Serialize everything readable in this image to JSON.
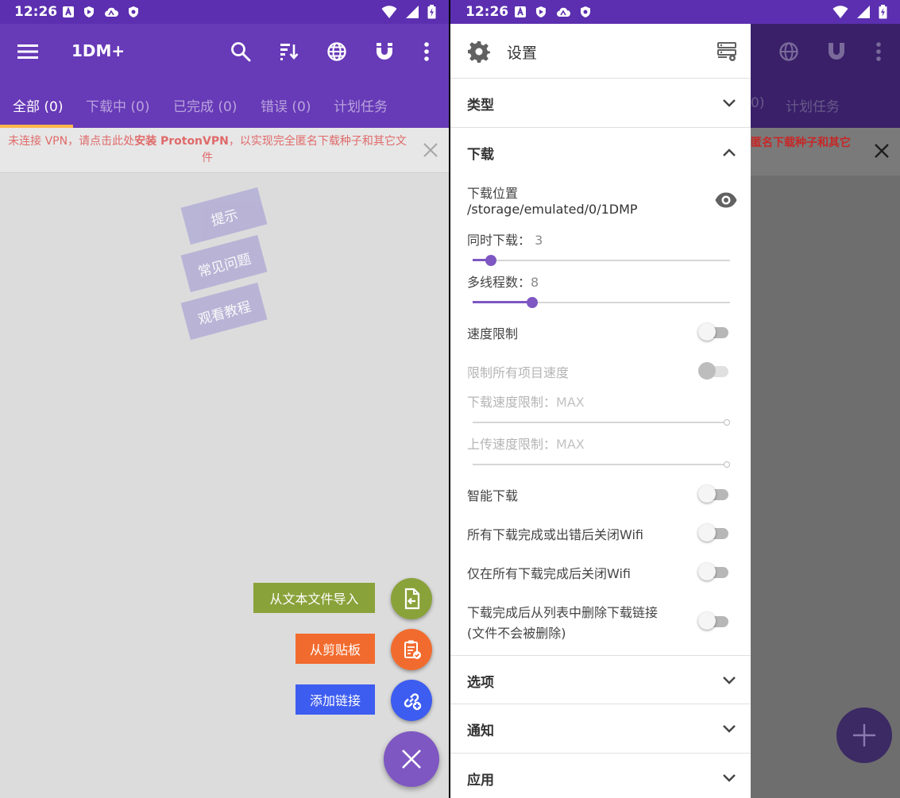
{
  "status_bar": {
    "time": "12:26"
  },
  "app": {
    "title": "1DM+",
    "tabs": [
      {
        "label": "全部 (0)"
      },
      {
        "label": "下载中 (0)"
      },
      {
        "label": "已完成 (0)"
      },
      {
        "label": "错误 (0)"
      },
      {
        "label": "计划任务"
      }
    ]
  },
  "banner": {
    "text_a": "未连接 VPN，请点击此处",
    "text_bold": "安装 ProtonVPN",
    "text_b": "，以实现完全匿名下载种子和其它文件",
    "dim_fragment": "匿名下载种子和其它"
  },
  "tips": [
    "提示",
    "常见问题",
    "观看教程"
  ],
  "fab": {
    "import_text_label": "从文本文件导入",
    "clipboard_label": "从剪贴板",
    "add_link_label": "添加链接",
    "colors": {
      "import": "#8aa23a",
      "clipboard": "#f26b2e",
      "link": "#3d5cf0",
      "main": "#7e57c2"
    }
  },
  "dim_tabs": {
    "errors_tail": "0)",
    "scheduled": "计划任务"
  },
  "settings": {
    "title": "设置",
    "sections": {
      "type": "类型",
      "download": "下载",
      "options": "选项",
      "notify": "通知",
      "apply": "应用"
    },
    "download": {
      "location_label": "下载位置",
      "location_path": "/storage/emulated/0/1DMP",
      "concurrent_label": "同时下载：",
      "concurrent_value": "3",
      "concurrent_fraction": 0.07,
      "threads_label": "多线程数：",
      "threads_value": "8",
      "threads_fraction": 0.23,
      "speed_limit": "速度限制",
      "limit_all": "限制所有项目速度",
      "download_limit_label": "下载速度限制：",
      "download_limit_value": "MAX",
      "upload_limit_label": "上传速度限制：",
      "upload_limit_value": "MAX",
      "smart_download": "智能下载",
      "wifi_off_all_done_or_error": "所有下载完成或出错后关闭Wifi",
      "wifi_off_all_done": "仅在所有下载完成后关闭Wifi",
      "remove_link_line1": "下载完成后从列表中删除下载链接",
      "remove_link_line2": "(文件不会被删除)"
    }
  }
}
